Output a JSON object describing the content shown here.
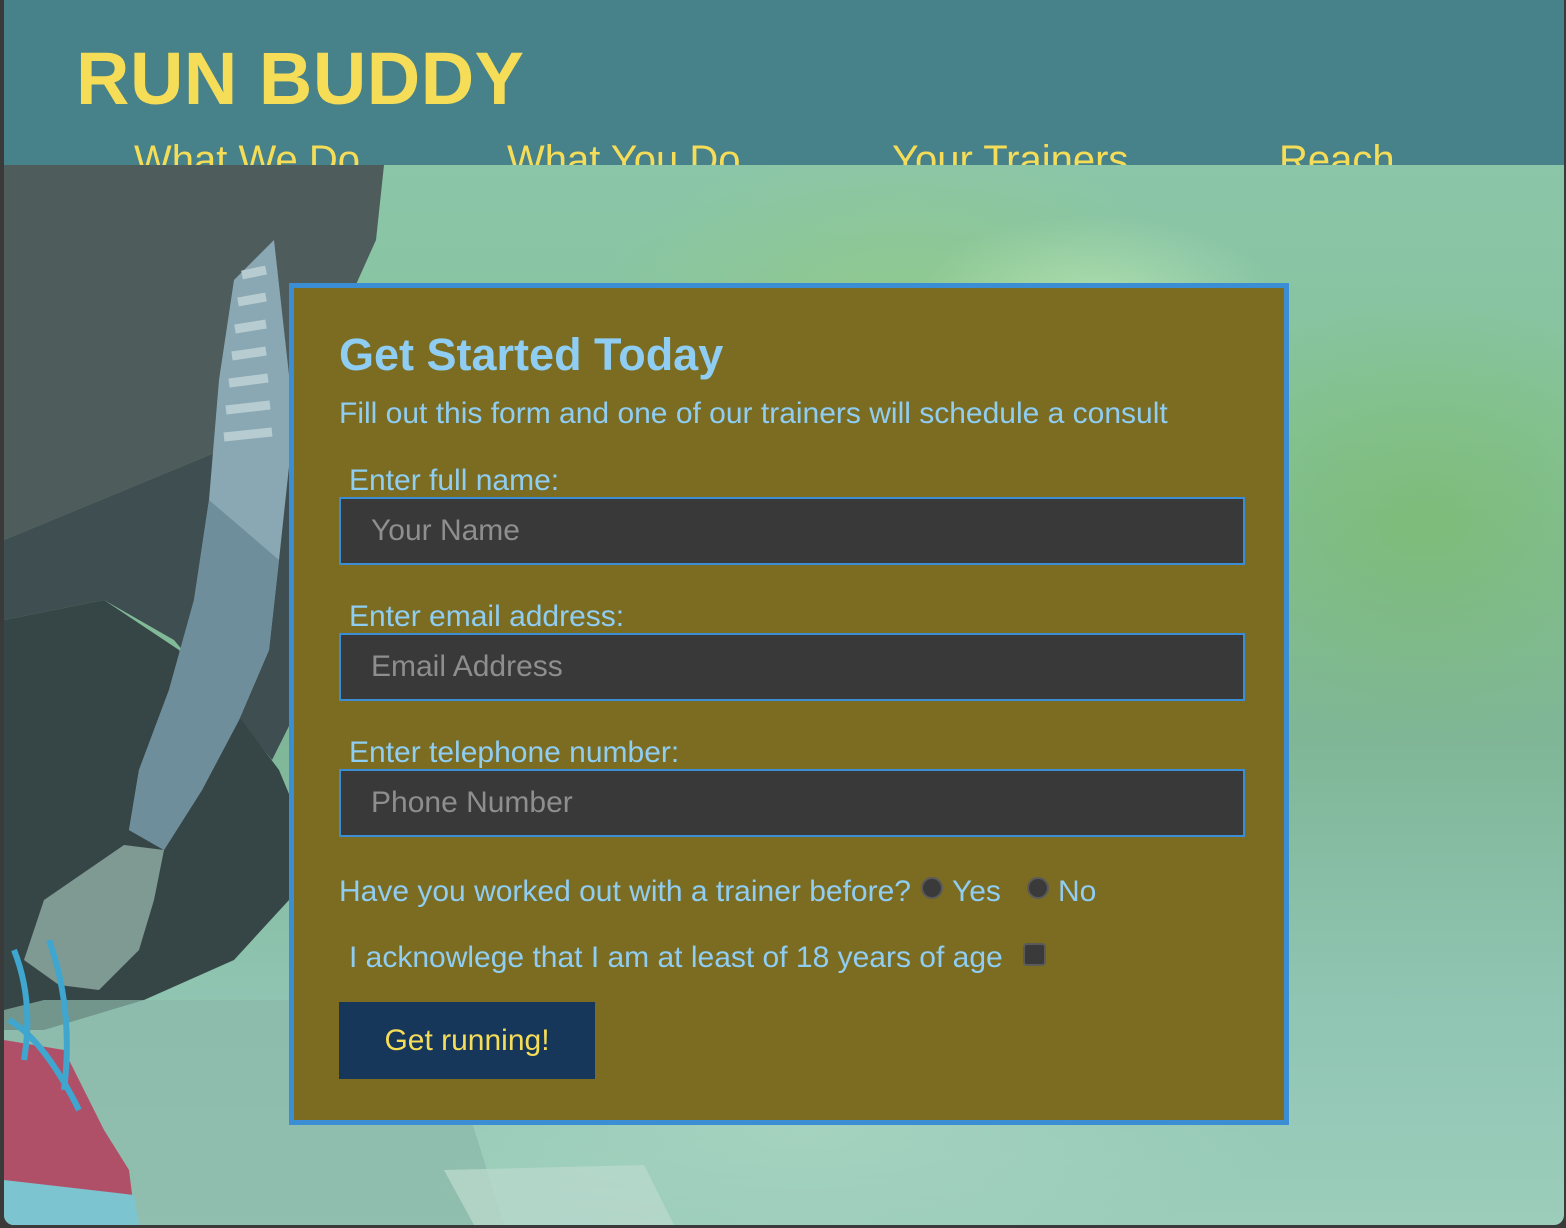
{
  "brand": {
    "title": "RUN BUDDY",
    "accent_color": "#f6dd58",
    "header_color": "#478189"
  },
  "nav": {
    "items": [
      {
        "label": "What We Do"
      },
      {
        "label": "What You Do"
      },
      {
        "label": "Your Trainers"
      },
      {
        "label": "Reach"
      }
    ]
  },
  "form": {
    "title": "Get Started Today",
    "subtitle": "Fill out this form and one of our trainers will schedule a consult",
    "fields": [
      {
        "label": "Enter full name:",
        "placeholder": "Your Name",
        "value": ""
      },
      {
        "label": "Enter email address:",
        "placeholder": "Email Address",
        "value": ""
      },
      {
        "label": "Enter telephone number:",
        "placeholder": "Phone Number",
        "value": ""
      }
    ],
    "trainer_question": {
      "label": "Have you worked out with a trainer before?",
      "options": [
        "Yes",
        "No"
      ]
    },
    "age_ack": {
      "label": "I acknowlege that I am at least of 18 years of age",
      "checked": false
    },
    "submit_label": "Get running!",
    "panel_color": "#7b6c21",
    "border_color": "#3b8ed4",
    "text_color": "#8fcdf2"
  },
  "icons": {
    "hero": "runner-tying-shoe-photo"
  }
}
